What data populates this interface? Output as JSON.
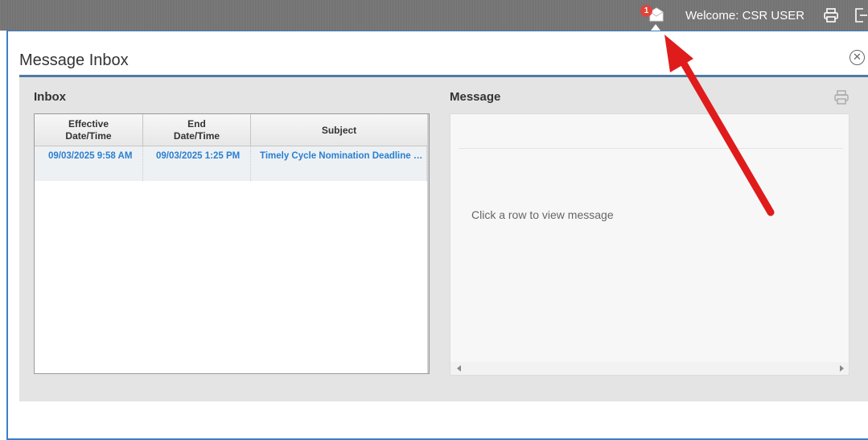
{
  "topbar": {
    "welcome_text": "Welcome: CSR USER",
    "message_badge_count": "1",
    "message_icon": "envelope-icon",
    "print_icon": "printer-icon",
    "exit_icon": "logout-icon"
  },
  "dialog": {
    "title": "Message Inbox",
    "close_icon": "close-circle-icon",
    "close_glyph": "✕"
  },
  "inbox": {
    "title": "Inbox",
    "columns": [
      {
        "label_line1": "Effective",
        "label_line2": "Date/Time"
      },
      {
        "label_line1": "End",
        "label_line2": "Date/Time"
      },
      {
        "label_line1": "Subject",
        "label_line2": ""
      }
    ],
    "rows": [
      {
        "effective": "09/03/2025 9:58 AM",
        "end": "09/03/2025 1:25 PM",
        "subject": "Timely Cycle Nomination Deadline Ext..."
      }
    ]
  },
  "message": {
    "title": "Message",
    "placeholder_text": "Click a row to view message",
    "print_icon": "printer-icon"
  },
  "colors": {
    "accent_blue": "#3b7fc4",
    "link_blue": "#2a7fd1",
    "badge_red": "#e0443b",
    "annotation_arrow_red": "#e01b1b"
  }
}
